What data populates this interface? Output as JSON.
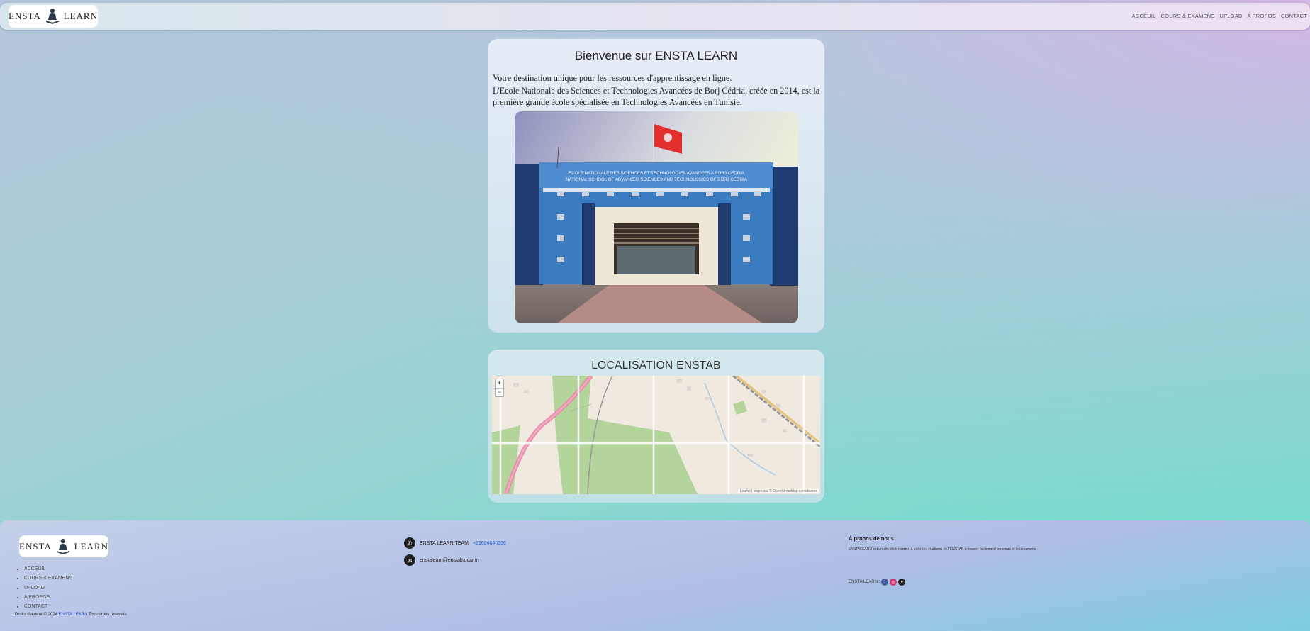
{
  "brand": {
    "logo_left": "ENSTA",
    "logo_right": "LEARN"
  },
  "nav": {
    "items": [
      "ACCEUIL",
      "COURS & EXAMENS",
      "UPLOAD",
      "A PROPOS",
      "CONTACT"
    ]
  },
  "welcome": {
    "title": "Bienvenue sur ENSTA LEARN",
    "line1": "Votre destination unique pour les ressources d'apprentissage en ligne.",
    "line2": "L'Ecole Nationale des Sciences et Technologies Avancées de Borj Cédria, créée en 2014, est la première grande école spécialisée en Technologies Avancées en Tunisie.",
    "sign_line1": "ECOLE NATIONALE DES SCIENCES ET TECHNOLOGIES AVANCEES A BORJ CEDRIA",
    "sign_line2": "NATIONAL SCHOOL OF ADVANCED SCIENCES AND TECHNOLOGIES OF BORJ CEDRIA"
  },
  "location": {
    "title": "LOCALISATION ENSTAB",
    "zoom_in": "+",
    "zoom_out": "−",
    "attribution": "Leaflet | Map data © OpenStreetMap contributors"
  },
  "footer": {
    "links": [
      "ACCEUIL",
      "COURS & EXAMENS",
      "UPLOAD",
      "A PROPOS",
      "CONTACT"
    ],
    "copyright_pre": "Droits d'auteur © 2024",
    "copyright_brand": "ENSTA LEARN",
    "copyright_post": "Tous droits réservés",
    "team": "ENSTA LEARN TEAM",
    "phone": "+21624640536",
    "email": "enstalearn@enstab.ucar.tn",
    "about_title": "À propos de nous",
    "about_text": "ENSTALEARN est un site Web destiné à aider les étudiants de l'ENSTAB à trouver facilement les cours et les examens",
    "social_label": "ENSTA LEARN :"
  },
  "colors": {
    "link_blue": "#2266cc",
    "facebook": "#3b5998",
    "instagram": "#d6336c",
    "github": "#222222"
  }
}
